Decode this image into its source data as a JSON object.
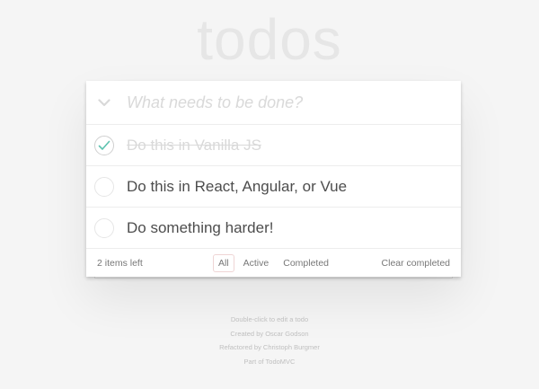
{
  "app": {
    "title": "todos"
  },
  "new_todo": {
    "placeholder": "What needs to be done?",
    "value": ""
  },
  "todos": [
    {
      "label": "Do this in Vanilla JS",
      "completed": true
    },
    {
      "label": "Do this in React, Angular, or Vue",
      "completed": false
    },
    {
      "label": "Do something harder!",
      "completed": false
    }
  ],
  "footer": {
    "count_text": "2 items left",
    "filters": [
      {
        "label": "All",
        "selected": true
      },
      {
        "label": "Active",
        "selected": false
      },
      {
        "label": "Completed",
        "selected": false
      }
    ],
    "clear_label": "Clear completed"
  },
  "info": {
    "line1": "Double-click to edit a todo",
    "line2_prefix": "Created by ",
    "line2_link": "Oscar Godson",
    "line3_prefix": "Refactored by ",
    "line3_link": "Christoph Burgmer",
    "line4_prefix": "Part of ",
    "line4_link": "TodoMVC"
  },
  "colors": {
    "background": "#f5f5f5",
    "title": "#e6e6e6",
    "text": "#4d4d4d",
    "completed_text": "#d9d9d9",
    "checkmark": "#5dc2af"
  },
  "icons": {
    "toggle_all": "chevron-down-icon",
    "completed_check": "check-icon"
  }
}
